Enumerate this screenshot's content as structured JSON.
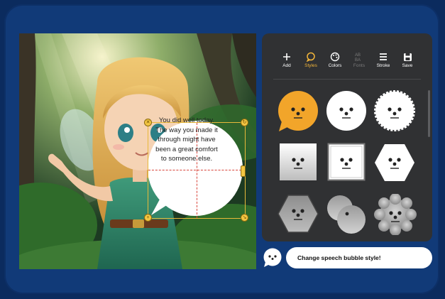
{
  "colors": {
    "page_bg": "#0b2b5e",
    "frame_bg": "#113a78",
    "panel_bg": "#303133",
    "accent": "#f2b53a",
    "guide": "#d8443a"
  },
  "bubble": {
    "lines": [
      "You did well today.",
      "The way you made it",
      "through might have",
      "been a great comfort",
      "to someone else."
    ]
  },
  "toolbar": {
    "items": [
      {
        "label": "Add",
        "icon": "plus-icon",
        "state": "normal"
      },
      {
        "label": "Styles",
        "icon": "speech-bubble-icon",
        "state": "active"
      },
      {
        "label": "Colors",
        "icon": "palette-icon",
        "state": "normal"
      },
      {
        "label": "Fonts",
        "icon": "font-icon",
        "state": "disabled"
      },
      {
        "label": "Stroke",
        "icon": "stroke-lines-icon",
        "state": "normal"
      },
      {
        "label": "Save",
        "icon": "save-icon",
        "state": "normal"
      }
    ],
    "fonts_glyph": "AB\nBA"
  },
  "styles": [
    {
      "name": "round-orange",
      "selected": true
    },
    {
      "name": "round-white"
    },
    {
      "name": "scalloped-white"
    },
    {
      "name": "square-gradient"
    },
    {
      "name": "square-bordered"
    },
    {
      "name": "hexagon-white"
    },
    {
      "name": "hexagon-gray"
    },
    {
      "name": "double-circle-gray"
    },
    {
      "name": "flower-gray"
    }
  ],
  "prompt": {
    "text": "Change speech bubble style!"
  }
}
